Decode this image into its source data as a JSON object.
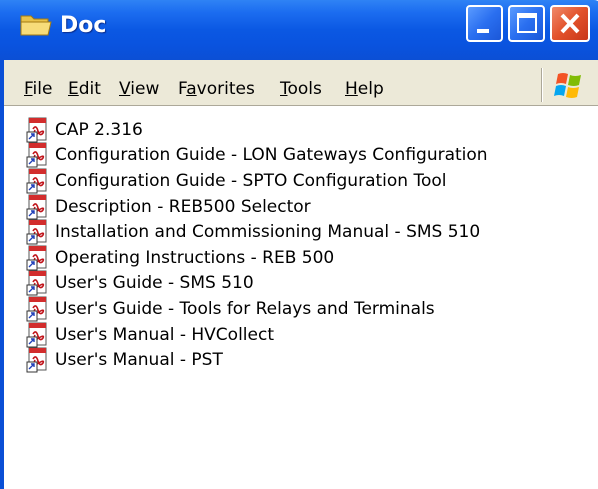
{
  "window": {
    "title": "Doc",
    "title_icon": "folder-icon",
    "controls": [
      "minimize-icon",
      "maximize-icon",
      "close-icon"
    ]
  },
  "menubar": {
    "items": [
      {
        "label": "File",
        "mnemonic": "F",
        "rest": "ile"
      },
      {
        "label": "Edit",
        "mnemonic": "E",
        "rest": "dit"
      },
      {
        "label": "View",
        "mnemonic": "V",
        "rest": "iew"
      },
      {
        "label": "Favorites",
        "pre": "F",
        "mnemonic": "a",
        "rest": "vorites"
      },
      {
        "label": "Tools",
        "mnemonic": "T",
        "rest": "ools"
      },
      {
        "label": "Help",
        "mnemonic": "H",
        "rest": "elp"
      }
    ],
    "logo_icon": "windows-logo-icon"
  },
  "files": [
    {
      "name": "CAP 2.316",
      "icon": "pdf-file-icon"
    },
    {
      "name": "Configuration Guide - LON Gateways Configuration",
      "icon": "pdf-file-icon"
    },
    {
      "name": "Configuration Guide - SPTO Configuration Tool",
      "icon": "pdf-file-icon"
    },
    {
      "name": "Description - REB500 Selector",
      "icon": "pdf-file-icon"
    },
    {
      "name": "Installation and Commissioning Manual - SMS 510",
      "icon": "pdf-file-icon"
    },
    {
      "name": "Operating Instructions - REB 500",
      "icon": "pdf-file-icon"
    },
    {
      "name": "User's Guide - SMS 510",
      "icon": "pdf-file-icon"
    },
    {
      "name": "User's Guide - Tools for Relays and Terminals",
      "icon": "pdf-file-icon"
    },
    {
      "name": "User's Manual - HVCollect",
      "icon": "pdf-file-icon"
    },
    {
      "name": "User's Manual - PST",
      "icon": "pdf-file-icon"
    }
  ],
  "colors": {
    "titlebar": "#0b58e3",
    "menubar": "#ece9d8",
    "close_button": "#e2512a"
  }
}
